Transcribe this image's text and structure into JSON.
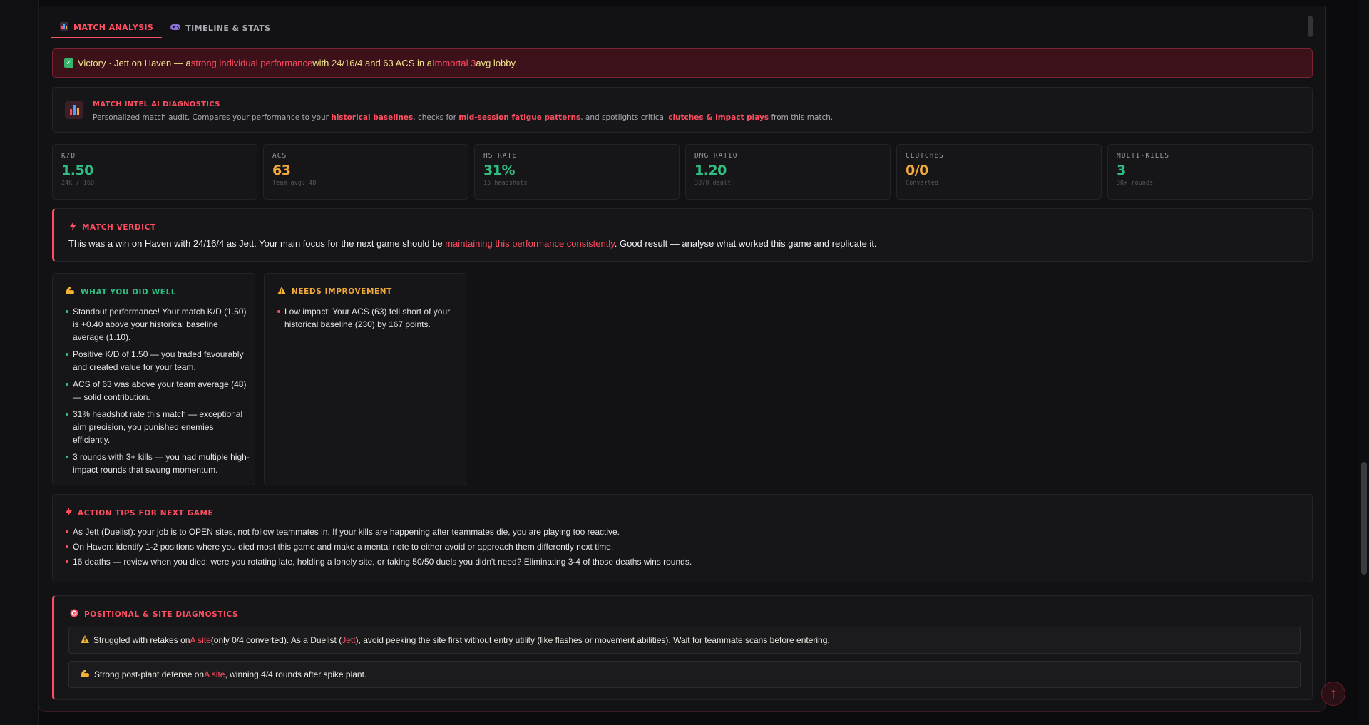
{
  "tabs": [
    {
      "label": "MATCH ANALYSIS",
      "icon": "bar-chart-icon"
    },
    {
      "label": "TIMELINE & STATS",
      "icon": "gamepad-icon"
    }
  ],
  "victory_banner": {
    "prefix": "Victory · Jett on Haven — a ",
    "highlight1": "strong individual performance",
    "middle": " with 24/16/4 and 63 ACS in a ",
    "highlight2": "Immortal 3",
    "suffix": " avg lobby."
  },
  "intel": {
    "title": "MATCH INTEL AI DIAGNOSTICS",
    "desc_1": "Personalized match audit. Compares your performance to your ",
    "desc_hl_1": "historical baselines",
    "desc_2": ", checks for ",
    "desc_hl_2": "mid-session fatigue patterns",
    "desc_3": ", and spotlights critical ",
    "desc_hl_3": "clutches & impact plays",
    "desc_4": " from this match."
  },
  "stats": [
    {
      "label": "K/D",
      "value": "1.50",
      "sub": "24K / 16D",
      "color": "#2fbf82"
    },
    {
      "label": "ACS",
      "value": "63",
      "sub": "Team avg: 48",
      "color": "#f2a93b"
    },
    {
      "label": "HS RATE",
      "value": "31%",
      "sub": "15 headshots",
      "color": "#2fbf82"
    },
    {
      "label": "DMG RATIO",
      "value": "1.20",
      "sub": "3870 dealt",
      "color": "#2fbf82"
    },
    {
      "label": "CLUTCHES",
      "value": "0/0",
      "sub": "Converted",
      "color": "#f2a93b"
    },
    {
      "label": "MULTI-KILLS",
      "value": "3",
      "sub": "3K+ rounds",
      "color": "#2fbf82"
    }
  ],
  "verdict": {
    "title": "MATCH VERDICT",
    "text_1": "This was a win on Haven with 24/16/4 as Jett. Your main focus for the next game should be ",
    "text_hl": "maintaining this performance consistently",
    "text_2": ". Good result — analyse what worked this game and replicate it."
  },
  "did_well": {
    "title": "WHAT YOU DID WELL",
    "items": [
      "Standout performance! Your match K/D (1.50) is +0.40 above your historical baseline average (1.10).",
      "Positive K/D of 1.50 — you traded favourably and created value for your team.",
      "ACS of 63 was above your team average (48) — solid contribution.",
      "31% headshot rate this match — exceptional aim precision, you punished enemies efficiently.",
      "3 rounds with 3+ kills — you had multiple high-impact rounds that swung momentum."
    ]
  },
  "needs_improvement": {
    "title": "NEEDS IMPROVEMENT",
    "items": [
      "Low impact: Your ACS (63) fell short of your historical baseline (230) by 167 points."
    ]
  },
  "action_tips": {
    "title": "ACTION TIPS FOR NEXT GAME",
    "items": [
      "As Jett (Duelist): your job is to OPEN sites, not follow teammates in. If your kills are happening after teammates die, you are playing too reactive.",
      "On Haven: identify 1-2 positions where you died most this game and make a mental note to either avoid or approach them differently next time.",
      "16 deaths — review when you died: were you rotating late, holding a lonely site, or taking 50/50 duels you didn't need? Eliminating 3-4 of those deaths wins rounds."
    ]
  },
  "positional": {
    "title": "POSITIONAL & SITE DIAGNOSTICS",
    "item1": {
      "t1": "Struggled with retakes on ",
      "hl1": "A site",
      "t2": " (only 0/4 converted). As a Duelist (",
      "hl2": "Jett",
      "t3": "), avoid peeking the site first without entry utility (like flashes or movement abilities). Wait for teammate scans before entering."
    },
    "item2": {
      "t1": "Strong post-plant defense on ",
      "hl1": "A site",
      "t2": ", winning 4/4 rounds after spike plant."
    }
  },
  "scroll_top_label": "↑",
  "colors": {
    "accent": "#ff4d61",
    "good": "#2fbf82",
    "warn": "#f2a93b",
    "banner_text": "#f1e58a"
  }
}
